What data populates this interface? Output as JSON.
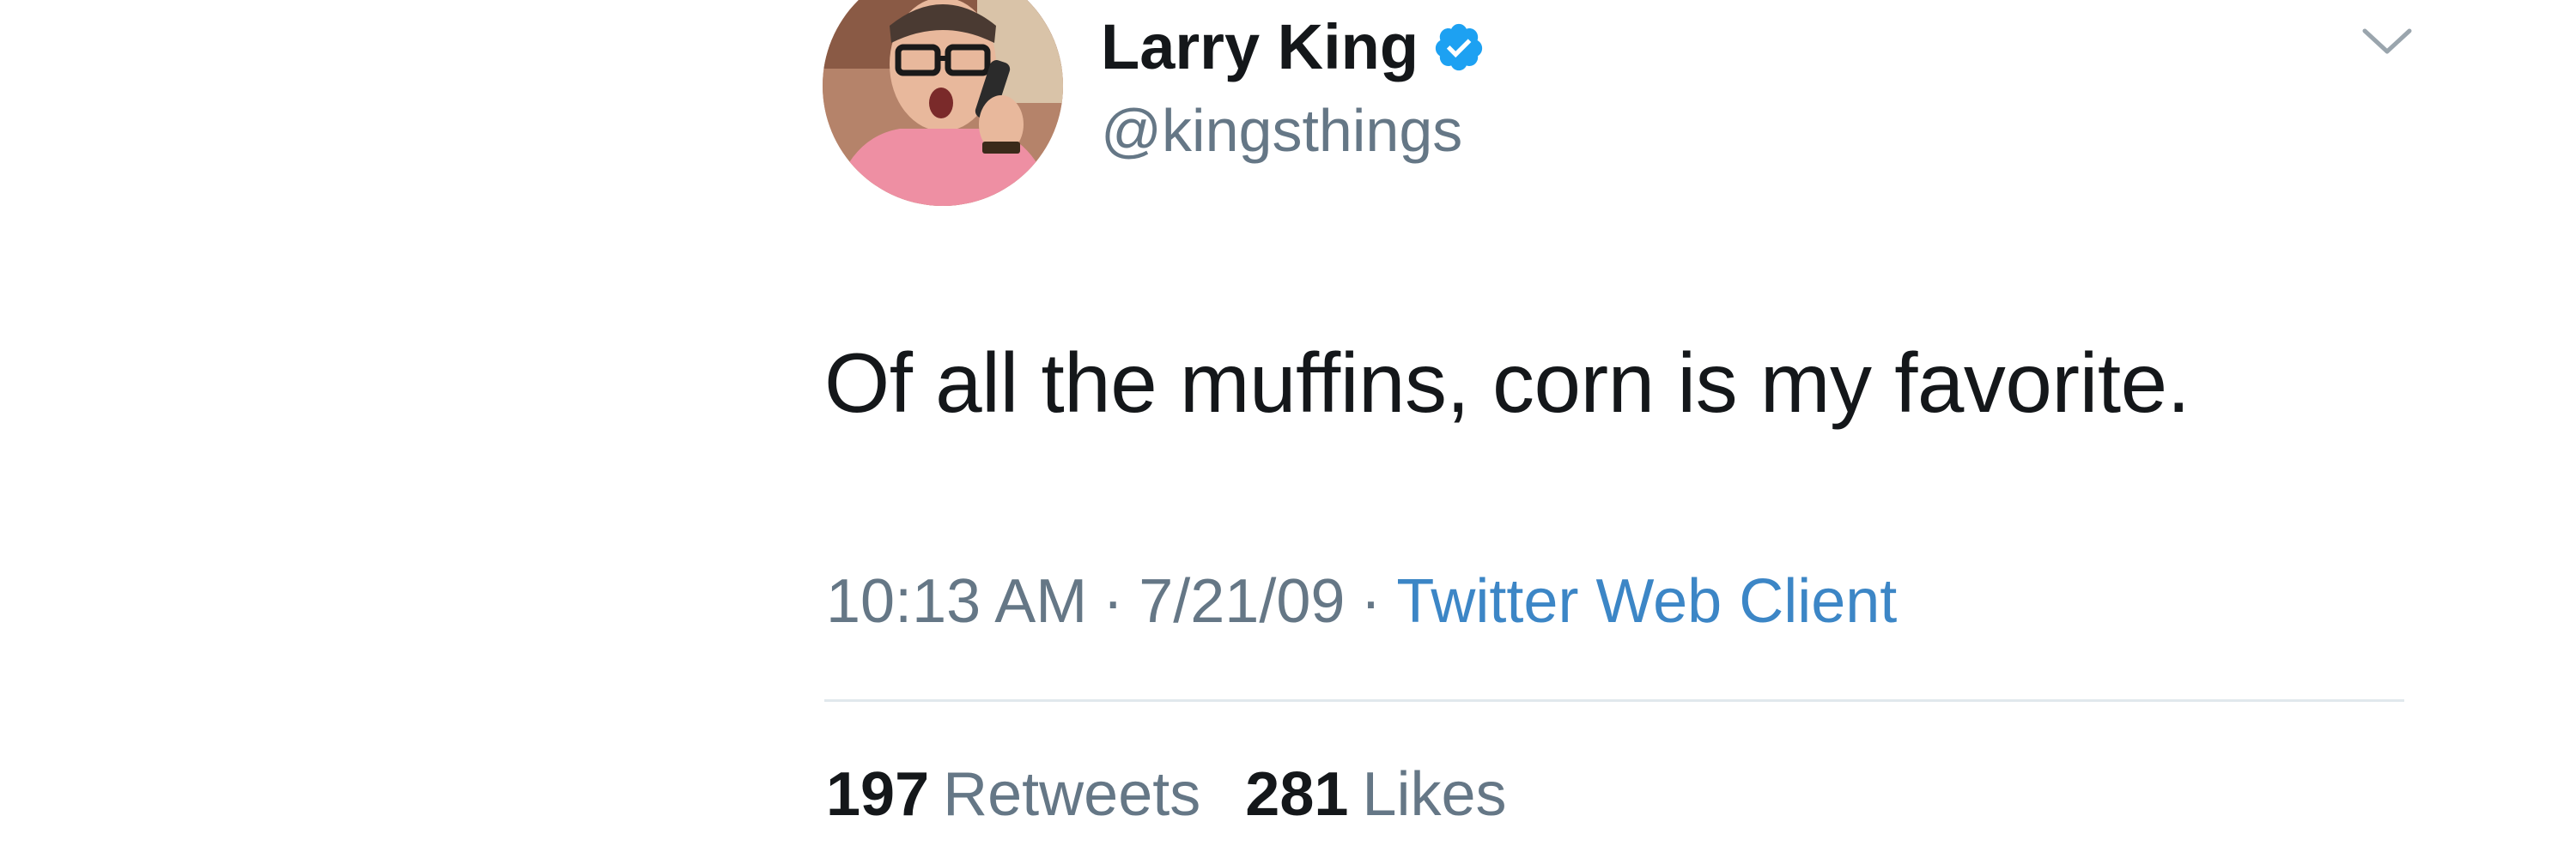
{
  "tweet": {
    "author": {
      "display_name": "Larry King",
      "handle": "@kingsthings",
      "verified": true,
      "avatar_icon": "profile-photo"
    },
    "text": "Of all the muffins, corn is my favorite.",
    "time": "10:13 AM",
    "separator": "·",
    "date": "7/21/09",
    "source": "Twitter Web Client",
    "retweets_count": "197",
    "retweets_label": "Retweets",
    "likes_count": "281",
    "likes_label": "Likes"
  },
  "colors": {
    "text": "#14171a",
    "secondary": "#657786",
    "link": "#3c86c6",
    "verified": "#1da1f2",
    "divider": "#e1e8ed"
  }
}
